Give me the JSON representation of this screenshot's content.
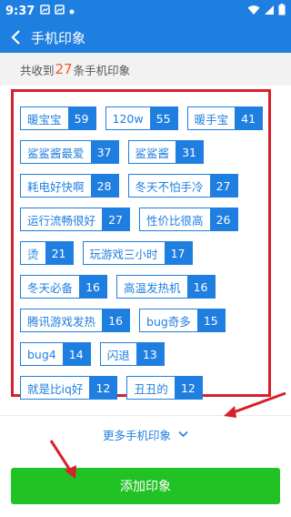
{
  "status_bar": {
    "time": "9:37"
  },
  "header": {
    "title": "手机印象"
  },
  "count_line": {
    "prefix": "共收到",
    "count": "27",
    "suffix": "条手机印象"
  },
  "tags": [
    {
      "label": "暖宝宝",
      "count": "59"
    },
    {
      "label": "120w",
      "count": "55"
    },
    {
      "label": "暖手宝",
      "count": "41"
    },
    {
      "label": "鲨鲨酱最爱",
      "count": "37"
    },
    {
      "label": "鲨鲨酱",
      "count": "31"
    },
    {
      "label": "耗电好快啊",
      "count": "28"
    },
    {
      "label": "冬天不怕手冷",
      "count": "27"
    },
    {
      "label": "运行流畅很好",
      "count": "27"
    },
    {
      "label": "性价比很高",
      "count": "26"
    },
    {
      "label": "烫",
      "count": "21"
    },
    {
      "label": "玩游戏三小时",
      "count": "17"
    },
    {
      "label": "冬天必备",
      "count": "16"
    },
    {
      "label": "高温发热机",
      "count": "16"
    },
    {
      "label": "腾讯游戏发热",
      "count": "16"
    },
    {
      "label": "bug奇多",
      "count": "15"
    },
    {
      "label": "bug4",
      "count": "14"
    },
    {
      "label": "闪退",
      "count": "13"
    },
    {
      "label": "就是比iq好",
      "count": "12"
    },
    {
      "label": "丑丑的",
      "count": "12"
    }
  ],
  "more": {
    "label": "更多手机印象"
  },
  "add_button": {
    "label": "添加印象"
  },
  "colors": {
    "primary": "#1f7fe0",
    "accent_count": "#f05a28",
    "button": "#21c324",
    "annotation": "#d8202a"
  }
}
